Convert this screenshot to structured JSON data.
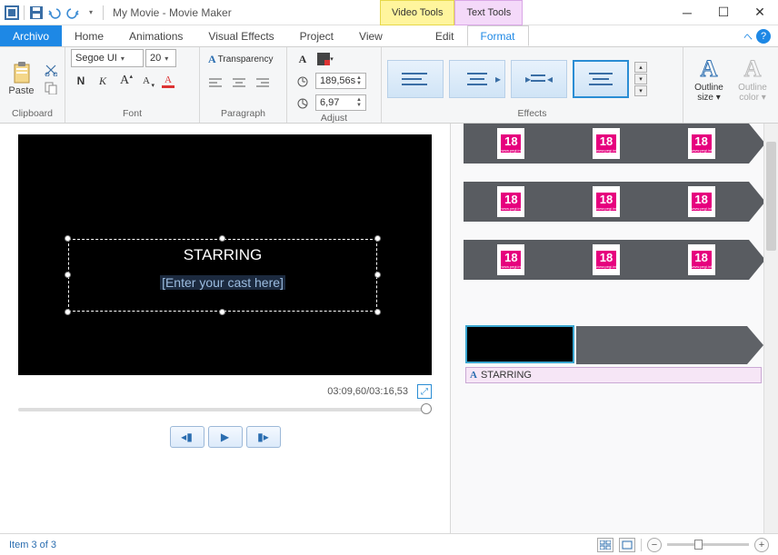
{
  "title": "My Movie - Movie Maker",
  "context_tabs": {
    "video": "Video Tools",
    "text": "Text Tools"
  },
  "tabs": {
    "file": "Archivo",
    "home": "Home",
    "animations": "Animations",
    "vfx": "Visual Effects",
    "project": "Project",
    "view": "View",
    "edit": "Edit",
    "format": "Format"
  },
  "ribbon": {
    "clipboard": {
      "label": "Clipboard",
      "paste": "Paste"
    },
    "font": {
      "label": "Font",
      "family": "Segoe UI",
      "size": "20",
      "transparency": "Transparency"
    },
    "paragraph": {
      "label": "Paragraph"
    },
    "adjust": {
      "label": "Adjust",
      "start_time": "189,56s",
      "duration": "6,97"
    },
    "effects": {
      "label": "Effects"
    },
    "outline": {
      "size": "Outline size",
      "size_dd": "▾",
      "color": "Outline color",
      "color_dd": "▾"
    }
  },
  "preview": {
    "title_text": "STARRING",
    "placeholder": "[Enter your cast here]",
    "time": "03:09,60/03:16,53"
  },
  "timeline": {
    "rating_number": "18",
    "rating_sub": "www.pegi.info",
    "caption_text": "STARRING"
  },
  "status": {
    "item": "Item 3 of 3"
  }
}
